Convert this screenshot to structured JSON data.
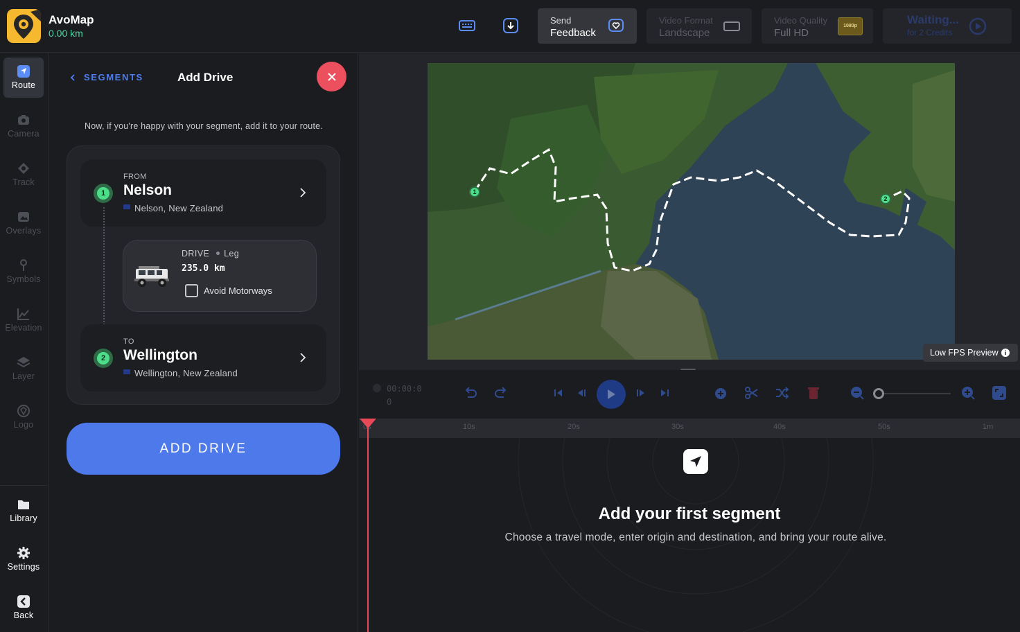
{
  "app": {
    "name": "AvoMap",
    "distance": "0.00 km"
  },
  "topbar": {
    "feedback": {
      "line1": "Send",
      "line2": "Feedback"
    },
    "video_format": {
      "line1": "Video Format",
      "line2": "Landscape"
    },
    "video_quality": {
      "line1": "Video Quality",
      "line2": "Full HD",
      "badge": "1080p"
    },
    "render": {
      "line1": "Waiting...",
      "line2": "for 2 Credits"
    }
  },
  "sidebar": {
    "items": [
      {
        "label": "Route",
        "icon": "route-icon"
      },
      {
        "label": "Camera",
        "icon": "camera-icon"
      },
      {
        "label": "Track",
        "icon": "track-icon"
      },
      {
        "label": "Overlays",
        "icon": "overlays-icon"
      },
      {
        "label": "Symbols",
        "icon": "symbols-icon"
      },
      {
        "label": "Elevation",
        "icon": "elevation-icon"
      },
      {
        "label": "Layer",
        "icon": "layer-icon"
      },
      {
        "label": "Logo",
        "icon": "logo-icon"
      }
    ],
    "bottom": [
      {
        "label": "Library",
        "icon": "folder-icon"
      },
      {
        "label": "Settings",
        "icon": "gear-icon"
      },
      {
        "label": "Back",
        "icon": "back-icon"
      }
    ]
  },
  "panel": {
    "back_link": "SEGMENTS",
    "title": "Add Drive",
    "intro": "Now, if you're happy with your segment, add it to your route.",
    "from": {
      "label": "FROM",
      "city": "Nelson",
      "full": "Nelson, New Zealand",
      "number": "1"
    },
    "drive": {
      "mode": "DRIVE",
      "leg": "Leg",
      "distance": "235.0 km",
      "avoid_label": "Avoid Motorways",
      "avoid_checked": false
    },
    "to": {
      "label": "TO",
      "city": "Wellington",
      "full": "Wellington, New Zealand",
      "number": "2"
    },
    "add_button": "ADD DRIVE"
  },
  "viewer": {
    "low_fps": "Low FPS Preview",
    "markers": [
      "1",
      "2"
    ]
  },
  "controls": {
    "timecode_line1": "00:00:0",
    "timecode_line2": "0"
  },
  "ruler": {
    "ticks": [
      "0s",
      "10s",
      "20s",
      "30s",
      "40s",
      "50s",
      "1m"
    ]
  },
  "empty_state": {
    "title": "Add your first segment",
    "subtitle": "Choose a travel mode, enter origin and destination, and bring your route alive."
  },
  "colors": {
    "accent": "#4e79ea",
    "green": "#4ed6a0",
    "danger": "#ec4f5e",
    "logo": "#f5b82e"
  }
}
